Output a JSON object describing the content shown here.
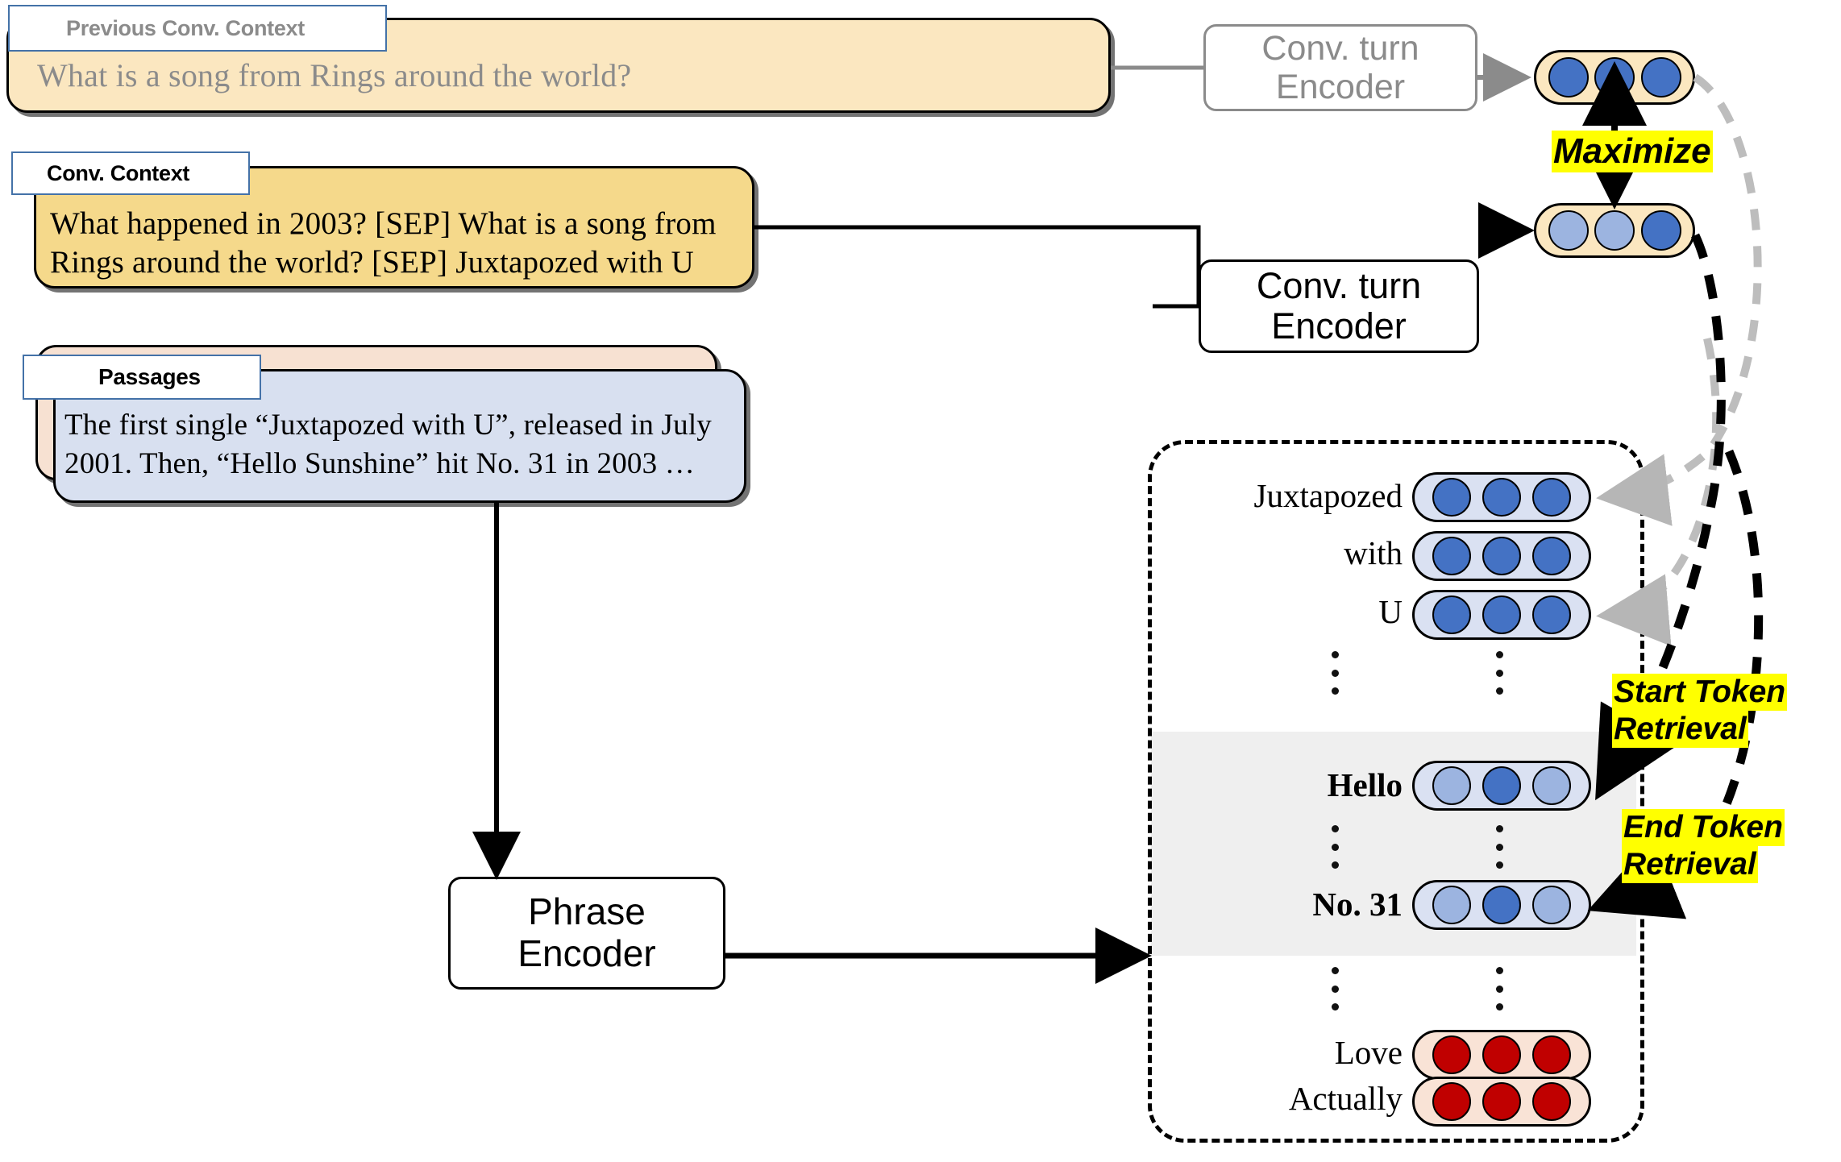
{
  "cards": {
    "previous_context": {
      "tag": "Previous Conv. Context",
      "text": "What is a song from Rings around the world?",
      "fill": "#fbe7c0",
      "text_color": "#8b8b8b"
    },
    "conv_context": {
      "tag": "Conv. Context",
      "line1": "What happened in 2003? [SEP] What is a song from",
      "line2": "Rings around the world? [SEP] Juxtapozed with U",
      "fill": "#f5d98b",
      "text_color": "#000000"
    },
    "passages": {
      "tag": "Passages",
      "line1": "The first single “Juxtapozed with U”, released in July",
      "line2": "2001. Then, “Hello Sunshine” hit No. 31 in 2003 …",
      "fill": "#d8e0f0",
      "back_fill": "#f7e1d2",
      "text_color": "#000000"
    }
  },
  "encoders": {
    "conv_turn_top": {
      "line1": "Conv. turn",
      "line2": "Encoder",
      "color": "#8b8b8b"
    },
    "conv_turn_bottom": {
      "line1": "Conv. turn",
      "line2": "Encoder",
      "color": "#000000"
    },
    "phrase": {
      "line1": "Phrase",
      "line2": "Encoder",
      "color": "#000000"
    }
  },
  "labels": {
    "maximize": "Maximize",
    "start_token_l1": "Start Token",
    "start_token_l2": "Retrieval",
    "end_token_l1": "End Token",
    "end_token_l2": "Retrieval",
    "highlight_color": "#ffff00"
  },
  "colors": {
    "dot_dark_blue": "#4472c4",
    "dot_light_blue": "#9cb4e0",
    "dot_red": "#c00000",
    "pill_cream": "#fbe7c0",
    "pill_blue": "#dae1f2",
    "pill_peach": "#f9e3d6",
    "band_gray": "#efefef",
    "tag_border": "#4472a8"
  },
  "query_vectors": [
    {
      "name": "previous-turn-vector",
      "pill_fill": "#fbe7c0",
      "dots": [
        "#4472c4",
        "#4472c4",
        "#4472c4"
      ]
    },
    {
      "name": "current-turn-vector",
      "pill_fill": "#fbe7c0",
      "dots": [
        "#9cb4e0",
        "#9cb4e0",
        "#4472c4"
      ]
    }
  ],
  "phrase_index": {
    "rows": [
      {
        "label": "Juxtapozed",
        "bold": false,
        "pill_fill": "#dae1f2",
        "dots": [
          "#4472c4",
          "#4472c4",
          "#4472c4"
        ]
      },
      {
        "label": "with",
        "bold": false,
        "pill_fill": "#dae1f2",
        "dots": [
          "#4472c4",
          "#4472c4",
          "#4472c4"
        ]
      },
      {
        "label": "U",
        "bold": false,
        "pill_fill": "#dae1f2",
        "dots": [
          "#4472c4",
          "#4472c4",
          "#4472c4"
        ]
      },
      {
        "label": "Hello",
        "bold": true,
        "pill_fill": "#dae1f2",
        "dots": [
          "#9cb4e0",
          "#4472c4",
          "#9cb4e0"
        ]
      },
      {
        "label": "No. 31",
        "bold": true,
        "pill_fill": "#dae1f2",
        "dots": [
          "#9cb4e0",
          "#4472c4",
          "#9cb4e0"
        ]
      },
      {
        "label": "Love",
        "bold": false,
        "pill_fill": "#f9e3d6",
        "dots": [
          "#c00000",
          "#c00000",
          "#c00000"
        ]
      },
      {
        "label": "Actually",
        "bold": false,
        "pill_fill": "#f9e3d6",
        "dots": [
          "#c00000",
          "#c00000",
          "#c00000"
        ]
      }
    ]
  }
}
